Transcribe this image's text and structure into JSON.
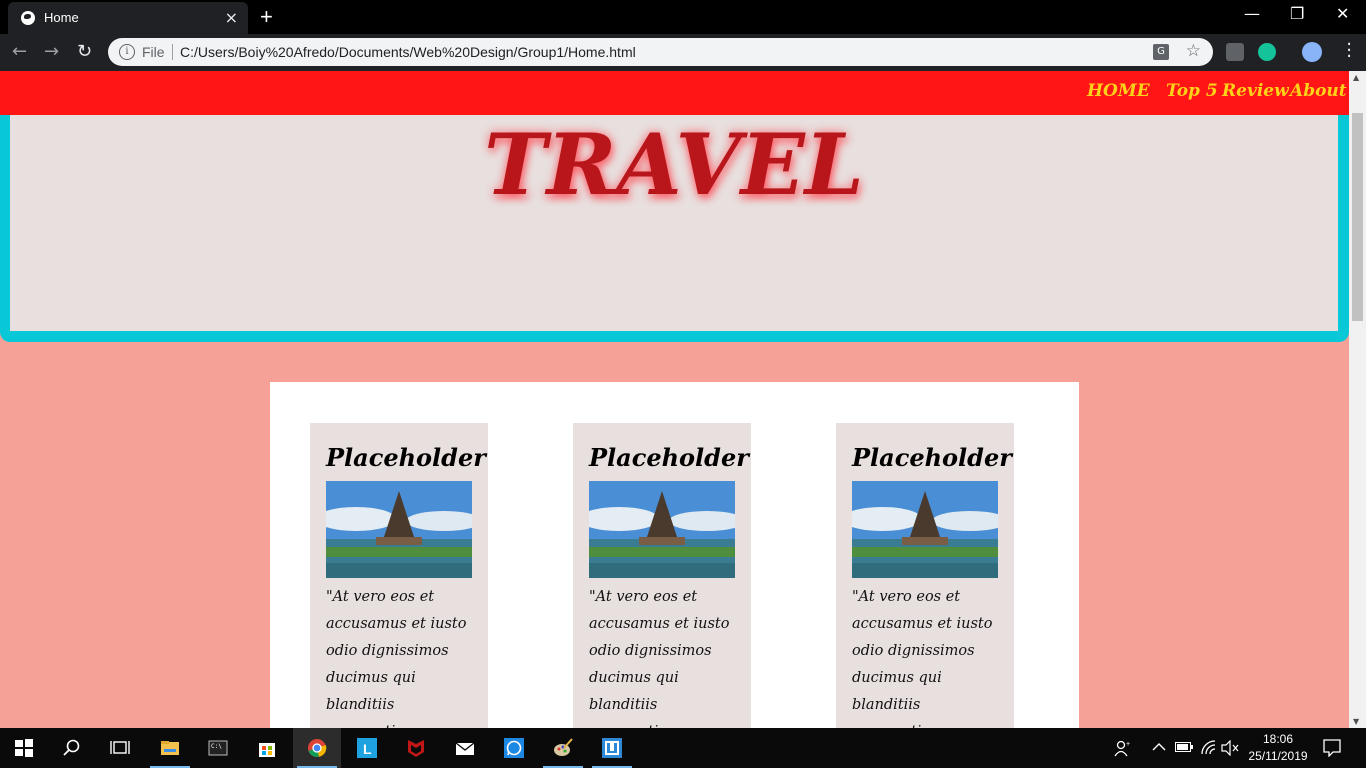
{
  "browser": {
    "tab_title": "Home",
    "close_glyph": "×",
    "new_tab_glyph": "+",
    "address_scheme_label": "File",
    "url": "C:/Users/Boiy%20Afredo/Documents/Web%20Design/Group1/Home.html",
    "window_controls": {
      "minimize": "—",
      "restore": "❐",
      "close": "✕"
    }
  },
  "site": {
    "nav": [
      "HOME",
      "Top 5",
      "Review",
      "About Us"
    ],
    "hero_title": "TRAVEL",
    "cards": [
      {
        "title": "Placeholder",
        "text": "\"At vero eos et accusamus et iusto odio dignissimos ducimus qui blanditiis praesentium voluptatum deleniti atque corrupti"
      },
      {
        "title": "Placeholder",
        "text": "\"At vero eos et accusamus et iusto odio dignissimos ducimus qui blanditiis praesentium voluptatum deleniti atque corrupti"
      },
      {
        "title": "Placeholder",
        "text": "\"At vero eos et accusamus et iusto odio dignissimos ducimus qui blanditiis praesentium voluptatum deleniti atque corrupti"
      }
    ]
  },
  "taskbar": {
    "time": "18:06",
    "date": "25/11/2019",
    "apps": [
      "start-icon",
      "search-icon",
      "task-view-icon",
      "file-explorer-icon",
      "terminal-icon",
      "store-icon",
      "chrome-icon",
      "l-app-icon",
      "mcafee-icon",
      "mail-icon",
      "whatsapp-icon",
      "paint-icon",
      "app-frame-icon"
    ]
  },
  "colors": {
    "nav_bg": "#ff1515",
    "nav_text": "#ffd21a",
    "hero_border": "#08c8d8",
    "page_bg": "#f5a197",
    "title_red": "#b8161b"
  }
}
